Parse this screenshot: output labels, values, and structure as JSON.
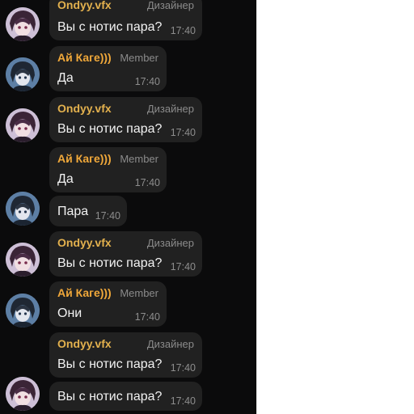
{
  "colors": {
    "background": "#0b0b0c",
    "bubble": "#212121",
    "name_ondyy": "#e3b14e",
    "name_kage": "#f0a83a",
    "meta_text": "#8b8b8b"
  },
  "avatars": {
    "ondyy": "anime-character-avatar-purple",
    "kage": "anime-character-avatar-blue"
  },
  "messages": [
    {
      "author": "Ondyy.vfx",
      "role": "Дизайнер",
      "text": "Вы с нотис пара?",
      "time": "17:40"
    },
    {
      "author": "Ай Каге)))",
      "role": "Member",
      "text": "Да",
      "time": "17:40"
    },
    {
      "author": "Ondyy.vfx",
      "role": "Дизайнер",
      "text": "Вы с нотис пара?",
      "time": "17:40"
    },
    {
      "author": "Ай Каге)))",
      "role": "Member",
      "text": "Да",
      "time": "17:40"
    },
    {
      "text": "Пара",
      "time": "17:40"
    },
    {
      "author": "Ondyy.vfx",
      "role": "Дизайнер",
      "text": "Вы с нотис пара?",
      "time": "17:40"
    },
    {
      "author": "Ай Каге)))",
      "role": "Member",
      "text": "Они",
      "time": "17:40"
    },
    {
      "author": "Ondyy.vfx",
      "role": "Дизайнер",
      "text": "Вы с нотис пара?",
      "time": "17:40"
    },
    {
      "text": "Вы с нотис пара?",
      "time": "17:40"
    }
  ]
}
